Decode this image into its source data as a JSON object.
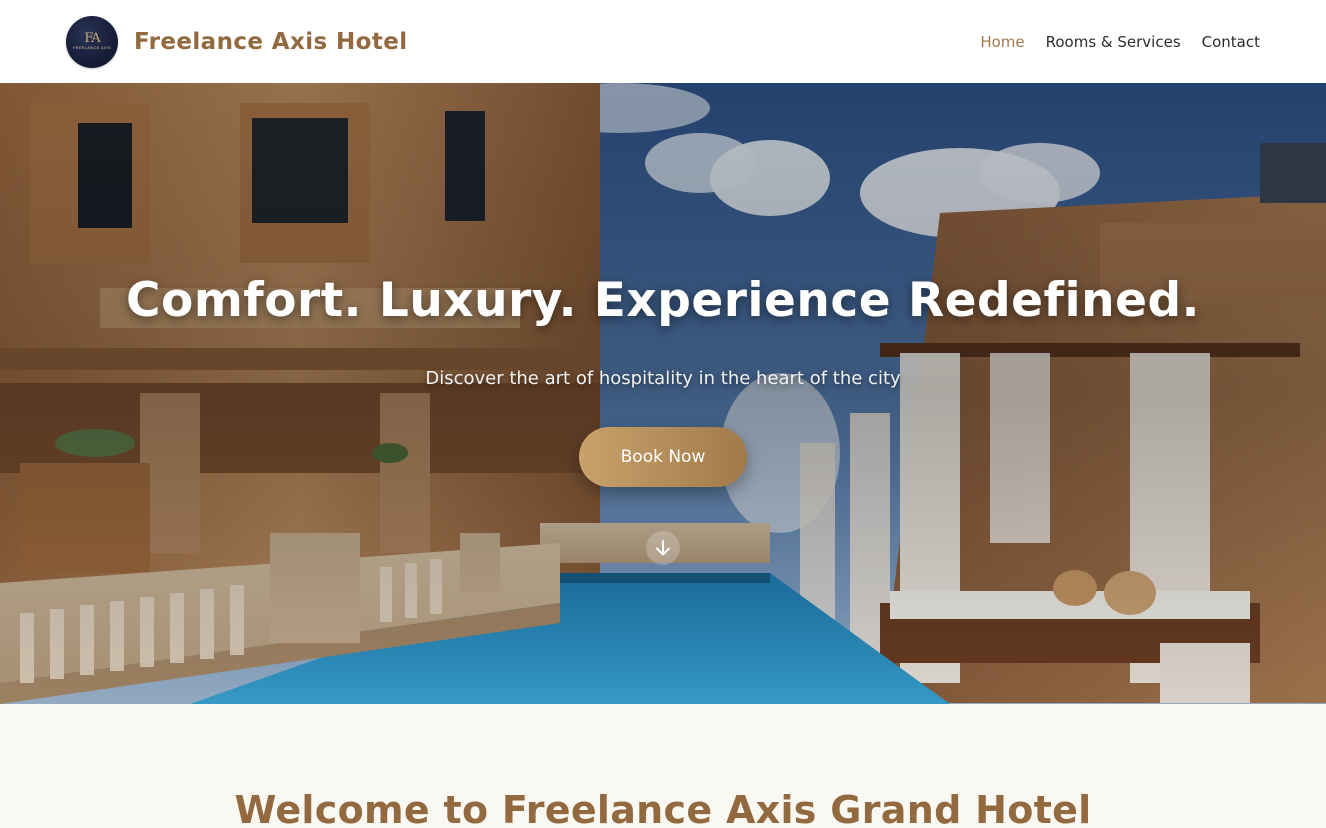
{
  "header": {
    "brand_name": "Freelance Axis Hotel",
    "logo_mark": "FA",
    "logo_subtext": "FREELANCE AXIS",
    "nav": {
      "home": "Home",
      "rooms": "Rooms & Services",
      "contact": "Contact"
    },
    "active_nav": "Home"
  },
  "hero": {
    "title": "Comfort. Luxury. Experience Redefined.",
    "subtitle": "Discover the art of hospitality in the heart of the city",
    "cta_label": "Book Now",
    "scroll_icon": "arrow-down-icon"
  },
  "welcome": {
    "title": "Welcome to Freelance Axis Grand Hotel"
  },
  "colors": {
    "brand": "#93693f",
    "accent_active": "#a0794e",
    "button_gradient_start": "#c8a16b",
    "button_gradient_end": "#a07a49",
    "welcome_bg": "#faf8f2",
    "logo_bg": "#131a33"
  }
}
